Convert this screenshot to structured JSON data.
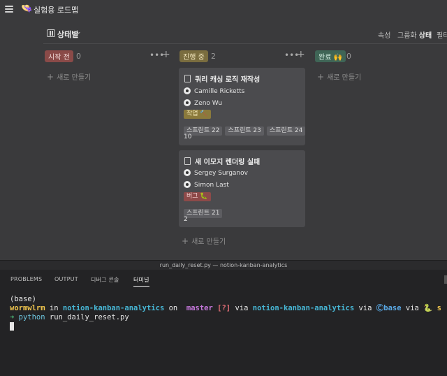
{
  "app": {
    "icon": "👒",
    "title": "실험용 로드맵"
  },
  "view": {
    "label": "상태별",
    "caret": "⌄"
  },
  "toolbar": {
    "properties": "속성",
    "group_prefix": "그룹화",
    "group_value": "상태",
    "filter": "필터"
  },
  "columns": [
    {
      "label": "시작 전",
      "count": "0",
      "new_label": "새로 만들기",
      "color": "#8a4a48",
      "text_color": "#f0d6d5"
    },
    {
      "label": "진행 중",
      "count": "2",
      "new_label": "새로 만들기",
      "color": "#7a6d3f",
      "text_color": "#f2e6bd"
    },
    {
      "label": "완료 🙌",
      "count": "0",
      "new_label": "새로 만들기",
      "color": "#3f6556",
      "text_color": "#d6f0e4"
    }
  ],
  "column_more": "•••",
  "column_add": "+",
  "cards": [
    {
      "title": "쿼리 캐싱 로직 재작성",
      "people": [
        "Camille Ricketts",
        "Zeno Wu"
      ],
      "tag": "작업 🔨",
      "tag_color": "#8b7a3c",
      "sprints": [
        "스프린트 22",
        "스프린트 23",
        "스프린트 24"
      ],
      "points": "10"
    },
    {
      "title": "새 이모지 렌더링 실패",
      "people": [
        "Sergey Surganov",
        "Simon Last"
      ],
      "tag": "버그 🐛",
      "tag_color": "#8d4a49",
      "sprints": [
        "스프린트 21"
      ],
      "points": "2"
    }
  ],
  "terminal": {
    "window_title": "run_daily_reset.py — notion-kanban-analytics",
    "tabs": [
      "PROBLEMS",
      "OUTPUT",
      "디버그 콘솔",
      "터미널"
    ],
    "active_tab": "터미널",
    "lines": {
      "env": "(base)",
      "user": "wormwlrm",
      "in": " in ",
      "dir": "notion-kanban-analytics",
      "on": " on ",
      "branch_icon": "",
      "branch": " master",
      "status": " [?]",
      "via1": " via ",
      "pyenv": "notion-kanban-analytics",
      "via2": " via ",
      "conda_icon": "Ⓒ",
      "conda": "base",
      "via3": " via ",
      "snake": "🐍",
      "tail": " s",
      "arrow": "➜",
      "cmd_python": " python",
      "cmd_arg": " run_daily_reset.py"
    }
  }
}
